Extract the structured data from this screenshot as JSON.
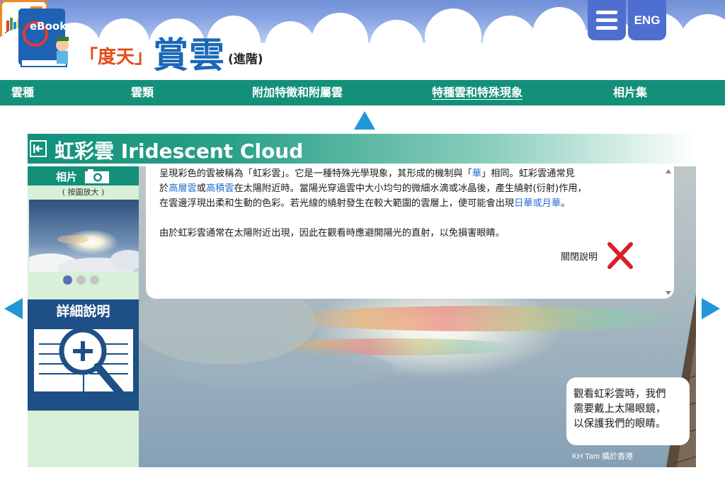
{
  "header": {
    "logo_text": "eBook",
    "title_bracket": "「度天」",
    "title_main": "賞雲",
    "title_level": "(進階)",
    "lang_label": "ENG"
  },
  "nav": {
    "items": [
      {
        "label": "雲種"
      },
      {
        "label": "雲類"
      },
      {
        "label": "附加特徵和附屬雲"
      },
      {
        "label": "特種雲和特殊現象"
      },
      {
        "label": "相片集"
      }
    ]
  },
  "section": {
    "title": "虹彩雲 Iridescent Cloud"
  },
  "left_panel": {
    "photo_label": "相片",
    "photo_hint": "( 按圖放大 )",
    "detail_label": "詳細說明"
  },
  "info": {
    "line1": "呈現彩色的雲被稱為「虹彩雲」。它是一種特殊光學現象，其形成的機制與「",
    "link_halo": "華",
    "line1b": "」相同。虹彩雲通常見",
    "line2a": "於",
    "link_altocumulus": "高層雲",
    "line2b": "或",
    "link_cirrocumulus": "高積雲",
    "line2c": "在太陽附近時。當陽光穿過雲中大小均勻的微細水滴或冰晶後，產生繞射(衍射)作用，",
    "line3a": "在雲邊浮現出柔和生動的色彩。若光線的繞射發生在較大範圍的雲層上，便可能會出現",
    "link_corona": "日華或月華",
    "line3b": "。",
    "line4": "由於虹彩雲通常在太陽附近出現，因此在觀看時應避開陽光的直射，以免損害眼睛。",
    "close_label": "關閉說明"
  },
  "bubble": {
    "line1": "觀看虹彩雲時，我們",
    "line2": "需要戴上太陽眼鏡，",
    "line3": "以保護我們的眼睛。"
  },
  "credit": "KH Tam 攝於香港",
  "colors": {
    "nav_green": "#14907a",
    "title_blue": "#1a68b8",
    "accent_orange": "#e64a19",
    "arrow_blue": "#2196d8",
    "link_blue": "#2a6fd0",
    "close_red": "#d8202a"
  }
}
